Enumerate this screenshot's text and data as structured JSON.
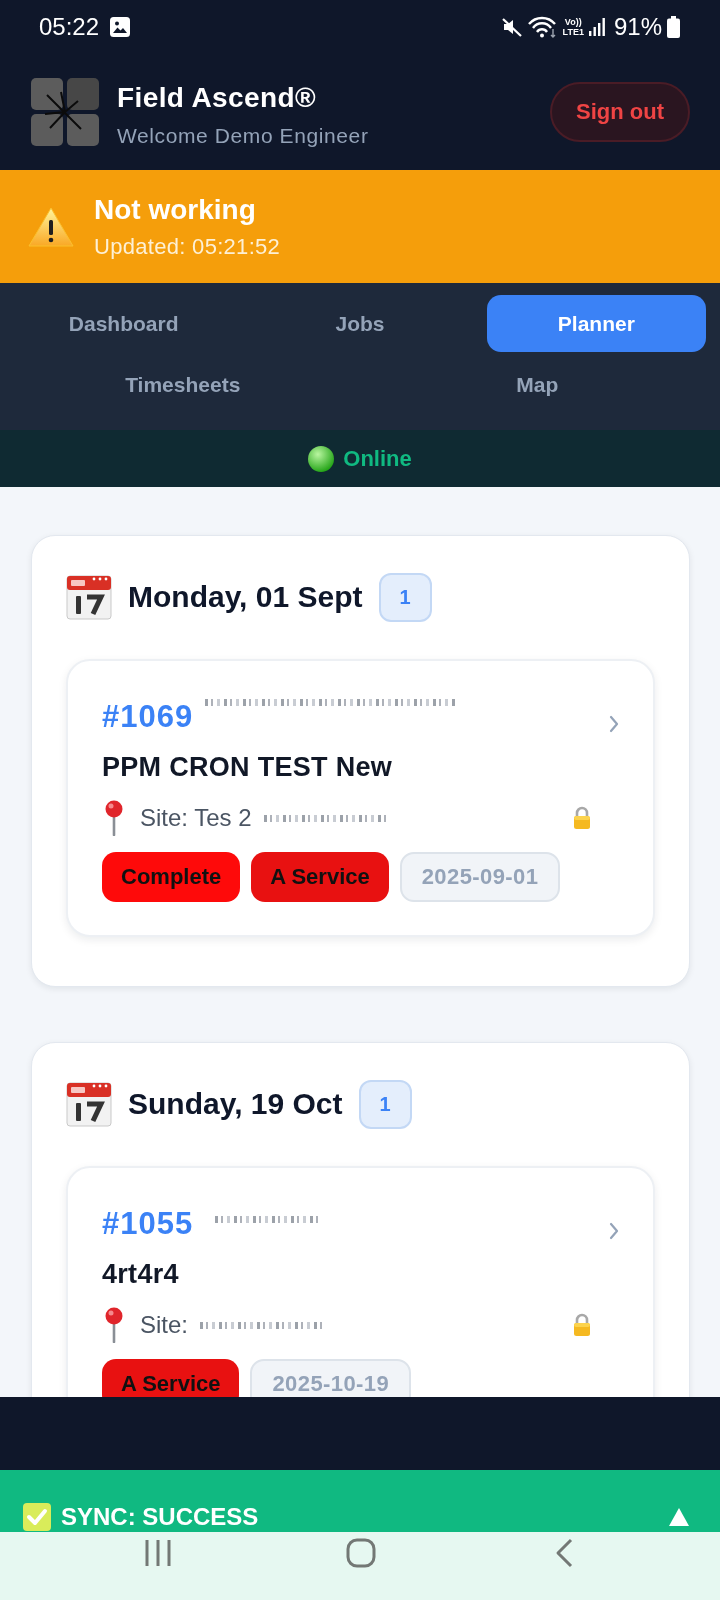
{
  "status_bar": {
    "time": "05:22",
    "network_top": "Vo))",
    "network_bottom": "LTE1",
    "battery": "91%"
  },
  "header": {
    "title": "Field Ascend®",
    "subtitle": "Welcome Demo Engineer",
    "sign_out": "Sign out"
  },
  "alert": {
    "title": "Not working",
    "updated": "Updated: 05:21:52"
  },
  "nav": {
    "tabs": [
      {
        "label": "Dashboard",
        "selected": false
      },
      {
        "label": "Jobs",
        "selected": false
      },
      {
        "label": "Planner",
        "selected": true
      },
      {
        "label": "Timesheets",
        "selected": false
      },
      {
        "label": "Map",
        "selected": false
      }
    ]
  },
  "connection": {
    "label": "Online",
    "online": true
  },
  "days": [
    {
      "date": "Monday, 01 Sept",
      "count": "1",
      "jobs": [
        {
          "number": "#1069",
          "customer_blurred": true,
          "title": "PPM CRON TEST New",
          "site": "Site: Tes 2",
          "address_blurred": true,
          "locked": true,
          "tags": [
            {
              "kind": "status",
              "label": "Complete",
              "color": "#fe0a0a"
            },
            {
              "kind": "service",
              "label": "A Service",
              "color": "#e81111"
            },
            {
              "kind": "date",
              "label": "2025-09-01"
            }
          ]
        }
      ]
    },
    {
      "date": "Sunday, 19 Oct",
      "count": "1",
      "jobs": [
        {
          "number": "#1055",
          "customer_blurred": true,
          "title": "4rt4r4",
          "site": "Site:",
          "address_blurred": true,
          "locked": true,
          "tags": [
            {
              "kind": "service",
              "label": "A Service",
              "color": "#e81111"
            },
            {
              "kind": "date",
              "label": "2025-10-19"
            }
          ]
        }
      ]
    }
  ],
  "sync": {
    "label": "SYNC: SUCCESS"
  }
}
